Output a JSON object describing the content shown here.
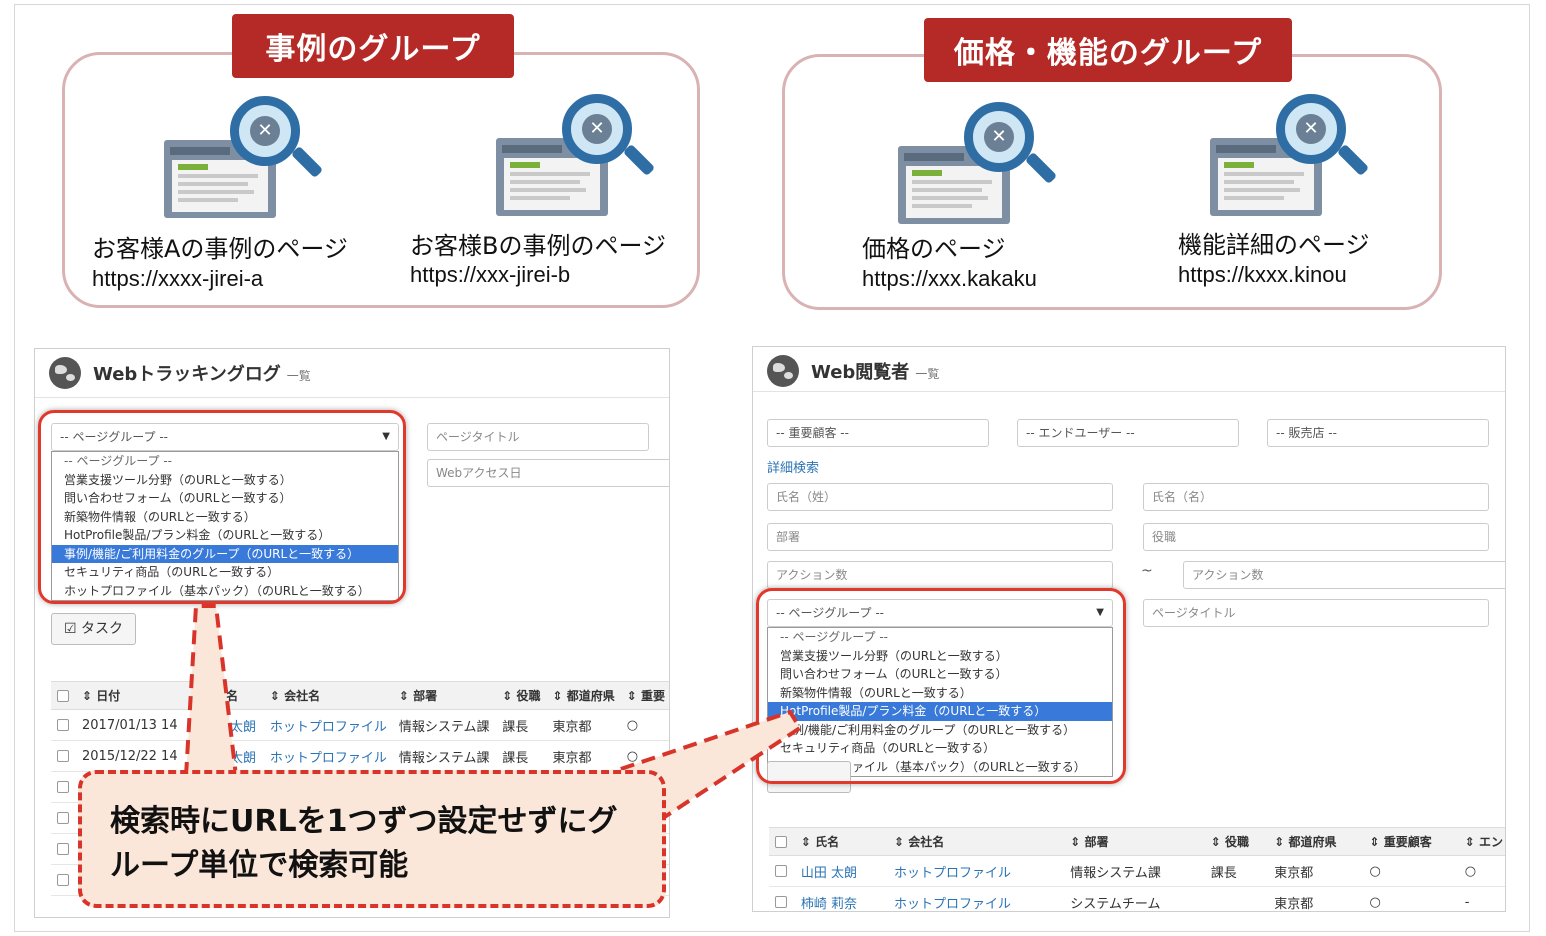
{
  "groups": [
    {
      "title": "事例のグループ",
      "pages": [
        {
          "label": "お客様Aの事例のページ",
          "url": "https://xxxx-jirei-a"
        },
        {
          "label": "お客様Bの事例のページ",
          "url": "https://xxx-jirei-b"
        }
      ]
    },
    {
      "title": "価格・機能のグループ",
      "pages": [
        {
          "label": "価格のページ",
          "url": "https://xxx.kakaku"
        },
        {
          "label": "機能詳細のページ",
          "url": "https://kxxx.kinou"
        }
      ]
    }
  ],
  "left_screen": {
    "title": "Webトラッキングログ",
    "subtitle": "一覧",
    "page_group_select": "-- ページグループ --",
    "page_title_placeholder": "ページタイトル",
    "web_access_date_placeholder": "Webアクセス日",
    "dropdown_options": [
      "-- ページグループ --",
      "営業支援ツール分野（のURLと一致する）",
      "問い合わせフォーム（のURLと一致する）",
      "新築物件情報（のURLと一致する）",
      "HotProfile製品/プラン料金（のURLと一致する）",
      "事例/機能/ご利用料金のグループ（のURLと一致する）",
      "セキュリティ商品（のURLと一致する）",
      "ホットプロファイル（基本パック）（のURLと一致する）"
    ],
    "task_button": "タスク",
    "columns": [
      "日付",
      "氏名",
      "会社名",
      "部署",
      "役職",
      "都道府県",
      "重要"
    ],
    "rows": [
      {
        "date": "2017/01/13 14",
        "name": "山田 太朗",
        "company": "ホットプロファイル",
        "dept": "情報システム課",
        "title": "課長",
        "pref": "東京都",
        "important": "○"
      },
      {
        "date": "2015/12/22 14",
        "name": "山田 太朗",
        "company": "ホットプロファイル",
        "dept": "情報システム課",
        "title": "課長",
        "pref": "東京都",
        "important": "○"
      }
    ]
  },
  "right_screen": {
    "title": "Web閲覧者",
    "subtitle": "一覧",
    "important_customer": "-- 重要顧客 --",
    "end_user": "-- エンドユーザー --",
    "reseller": "-- 販売店 --",
    "advanced_search": "詳細検索",
    "last_name": "氏名（姓）",
    "first_name": "氏名（名）",
    "department": "部署",
    "position": "役職",
    "action_count_from": "アクション数",
    "tilde": "~",
    "action_count_to": "アクション数",
    "page_group_select": "-- ページグループ --",
    "page_title_placeholder": "ページタイトル",
    "dropdown_options": [
      "-- ページグループ --",
      "営業支援ツール分野（のURLと一致する）",
      "問い合わせフォーム（のURLと一致する）",
      "新築物件情報（のURLと一致する）",
      "HotProfile製品/プラン料金（のURLと一致する）",
      "事例/機能/ご利用料金のグループ（のURLと一致する）",
      "セキュリティ商品（のURLと一致する）",
      "ホットプロファイル（基本パック）（のURLと一致する）"
    ],
    "columns": [
      "氏名",
      "会社名",
      "部署",
      "役職",
      "都道府県",
      "重要顧客",
      "エン"
    ],
    "rows": [
      {
        "name": "山田 太朗",
        "company": "ホットプロファイル",
        "dept": "情報システム課",
        "title": "課長",
        "pref": "東京都",
        "important": "○",
        "end": "○"
      },
      {
        "name": "柿崎 莉奈",
        "company": "ホットプロファイル",
        "dept": "システムチーム",
        "title": "",
        "pref": "東京都",
        "important": "○",
        "end": "-"
      }
    ]
  },
  "callout": {
    "line1": "検索時にURLを1つずつ設定せずにグ",
    "line2": "ループ単位で検索可能"
  },
  "colors": {
    "accent_red": "#b52a26",
    "dashed_red": "#d8342a",
    "link_blue": "#2b74b5",
    "selected_blue": "#3879d9"
  }
}
